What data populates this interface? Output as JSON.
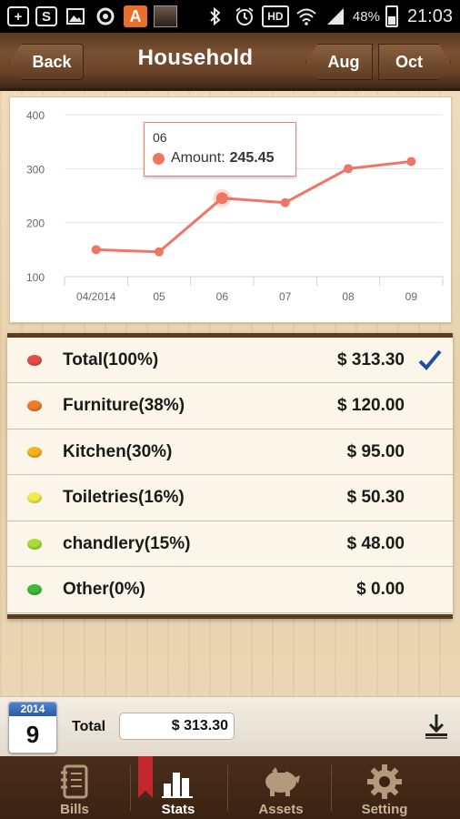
{
  "status_bar": {
    "battery": "48%",
    "time": "21:03",
    "icons": [
      "add-icon",
      "sync-icon",
      "image-icon",
      "circle-icon",
      "app-a-icon",
      "photo-icon",
      "bluetooth-icon",
      "alarm-icon",
      "hd-icon",
      "wifi-icon",
      "signal-icon",
      "battery-icon"
    ]
  },
  "header": {
    "back_label": "Back",
    "title": "Household",
    "prev_month_label": "Aug",
    "next_month_label": "Oct"
  },
  "chart_data": {
    "type": "line",
    "categories": [
      "04/2014",
      "05",
      "06",
      "07",
      "08",
      "09"
    ],
    "y_ticks": [
      "400",
      "300",
      "200",
      "100"
    ],
    "ylim": [
      100,
      400
    ],
    "series": [
      {
        "values": [
          150,
          146,
          245.45,
          237,
          300,
          313.3
        ],
        "color": "#f07565"
      }
    ],
    "tooltip": {
      "x_label": "06",
      "series_label": "Amount:",
      "value": "245.45"
    },
    "grid": true
  },
  "categories_list": [
    {
      "label": "Total(100%)",
      "amount": "$ 313.30",
      "color": "#e84a4a",
      "checked": true
    },
    {
      "label": "Furniture(38%)",
      "amount": "$ 120.00",
      "color": "#f07c2a",
      "checked": false
    },
    {
      "label": "Kitchen(30%)",
      "amount": "$ 95.00",
      "color": "#f3b21e",
      "checked": false
    },
    {
      "label": "Toiletries(16%)",
      "amount": "$ 50.30",
      "color": "#f2ec4c",
      "checked": false
    },
    {
      "label": "chandlery(15%)",
      "amount": "$ 48.00",
      "color": "#a8dc3a",
      "checked": false
    },
    {
      "label": "Other(0%)",
      "amount": "$ 0.00",
      "color": "#3bbd3b",
      "checked": false
    }
  ],
  "summary": {
    "calendar_year": "2014",
    "calendar_month": "9",
    "total_label": "Total",
    "total_value": "$ 313.30"
  },
  "tabs": [
    {
      "label": "Bills",
      "icon": "notebook-icon",
      "active": false
    },
    {
      "label": "Stats",
      "icon": "bar-chart-icon",
      "active": true
    },
    {
      "label": "Assets",
      "icon": "piggy-bank-icon",
      "active": false
    },
    {
      "label": "Setting",
      "icon": "gear-icon",
      "active": false
    }
  ]
}
